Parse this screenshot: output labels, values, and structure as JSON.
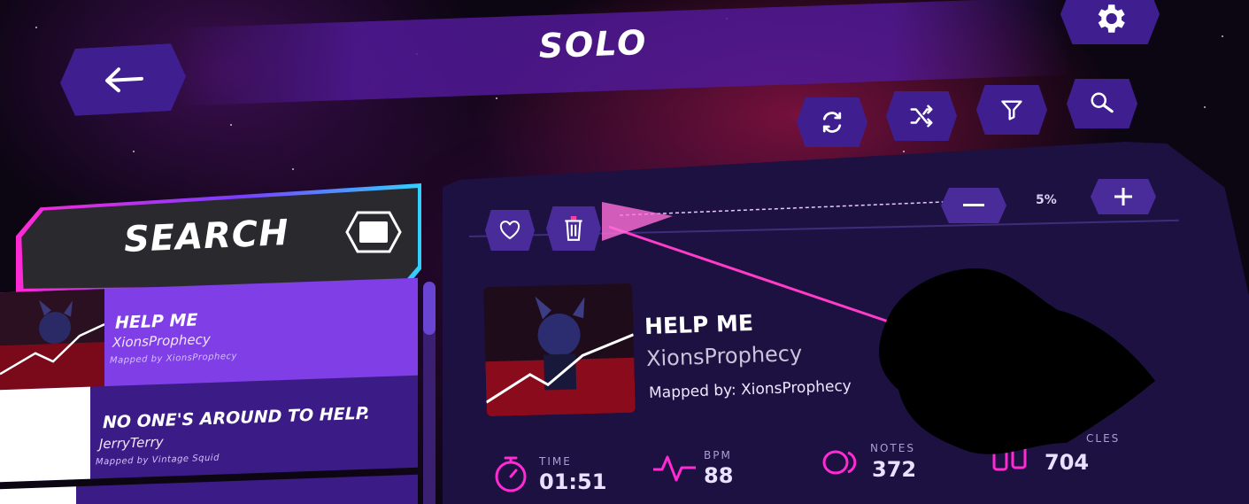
{
  "title": "SOLO",
  "search": {
    "label": "SEARCH"
  },
  "toolbar": {
    "refresh_icon": "refresh-icon",
    "shuffle_icon": "shuffle-icon",
    "filter_icon": "filter-icon",
    "search_icon": "magnifier-icon",
    "settings_icon": "gear-icon"
  },
  "songs": [
    {
      "title": "HELP ME",
      "artist": "XionsProphecy",
      "mapper": "Mapped by XionsProphecy"
    },
    {
      "title": "NO ONE'S AROUND TO HELP.",
      "artist": "JerryTerry",
      "mapper": "Mapped by Vintage Squid"
    }
  ],
  "detail": {
    "title": "HELP ME",
    "artist": "XionsProphecy",
    "mapper": "Mapped by: XionsProphecy",
    "volume": "5%",
    "stats": [
      {
        "label": "TIME",
        "value": "01:51"
      },
      {
        "label": "BPM",
        "value": "88"
      },
      {
        "label": "NOTES",
        "value": "372"
      },
      {
        "label": "CLES",
        "value": "704"
      }
    ]
  },
  "colors": {
    "accent": "#ff2ad4",
    "panel": "#1c1140",
    "button": "#3f1f8f",
    "list": "#7f3ee6"
  }
}
